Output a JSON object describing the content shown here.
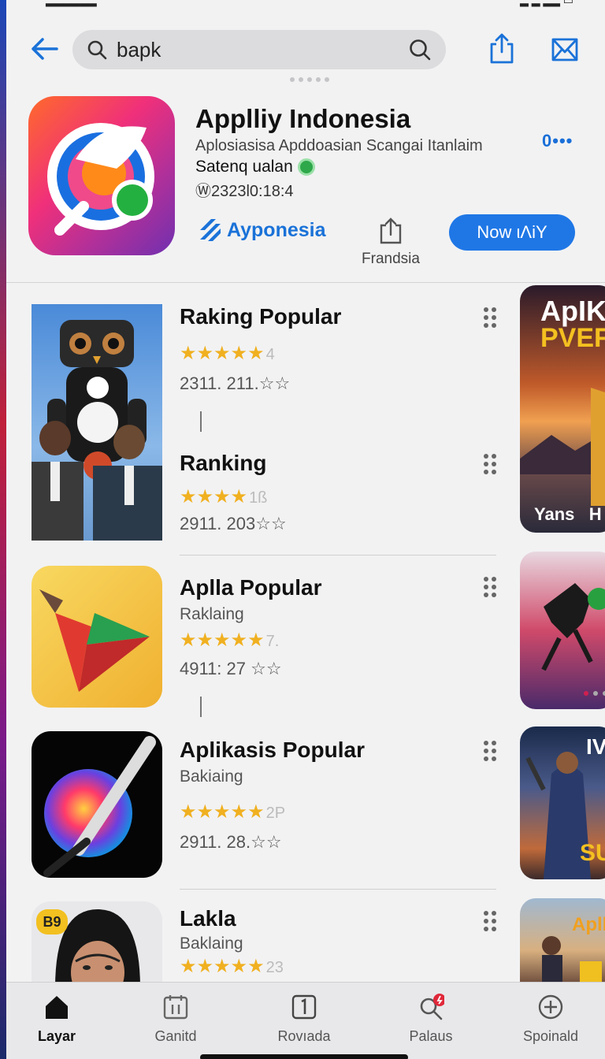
{
  "search": {
    "query": "bapk"
  },
  "header_app": {
    "title": "Applliy Indonesia",
    "subtitle": "Aplosiasisa Apddoasian Scangai Itanlaim",
    "status": "Satenq ualan",
    "meta": "Ⓦ2323l0:18:4",
    "more_label": "0•••",
    "developer_label": "Ayponesia",
    "secondary_label": "Frandsia",
    "install_label": "Now ιΛiY"
  },
  "list": [
    {
      "title": "Raking Popular",
      "subtitle": "",
      "stars": "★★★★★",
      "rating_suffix": "4",
      "meta": "2311. 211.☆☆"
    },
    {
      "title": "Ranking",
      "subtitle": "",
      "stars": "★★★★",
      "rating_suffix": "1ß",
      "meta": "2911. 203☆☆"
    },
    {
      "title": "Aplla Popular",
      "subtitle": "Raklaing",
      "stars": "★★★★★",
      "rating_suffix": "7.",
      "meta": "4911: 27 ☆☆"
    },
    {
      "title": "Aplikasis Popular",
      "subtitle": "Bakiaing",
      "stars": "★★★★★",
      "rating_suffix": "2P",
      "meta": "2911. 28.☆☆"
    },
    {
      "title": "Lakla",
      "subtitle": "Baklaing",
      "stars": "★★★★★",
      "rating_suffix": "23",
      "meta": ""
    }
  ],
  "side_cards": [
    {
      "top": "ApIK",
      "mid": "PVEF",
      "bottom": "Yans   H"
    },
    {
      "top": "",
      "mid": "",
      "bottom": ""
    },
    {
      "top": "IV",
      "mid": "SU",
      "bottom": ""
    },
    {
      "top": "Apll",
      "mid": "",
      "bottom": ""
    }
  ],
  "badge_label": "B9",
  "bottom_nav": [
    {
      "label": "Layar",
      "icon": "home-icon",
      "active": true
    },
    {
      "label": "Ganitd",
      "icon": "calendar-icon",
      "active": false
    },
    {
      "label": "Rovıada",
      "icon": "updates-icon",
      "active": false
    },
    {
      "label": "Palaus",
      "icon": "search-icon",
      "active": false
    },
    {
      "label": "Spoinald",
      "icon": "add-circle-icon",
      "active": false
    }
  ],
  "colors": {
    "accent": "#1f77e6",
    "star": "#f0b020",
    "badge": "#e0283a"
  }
}
